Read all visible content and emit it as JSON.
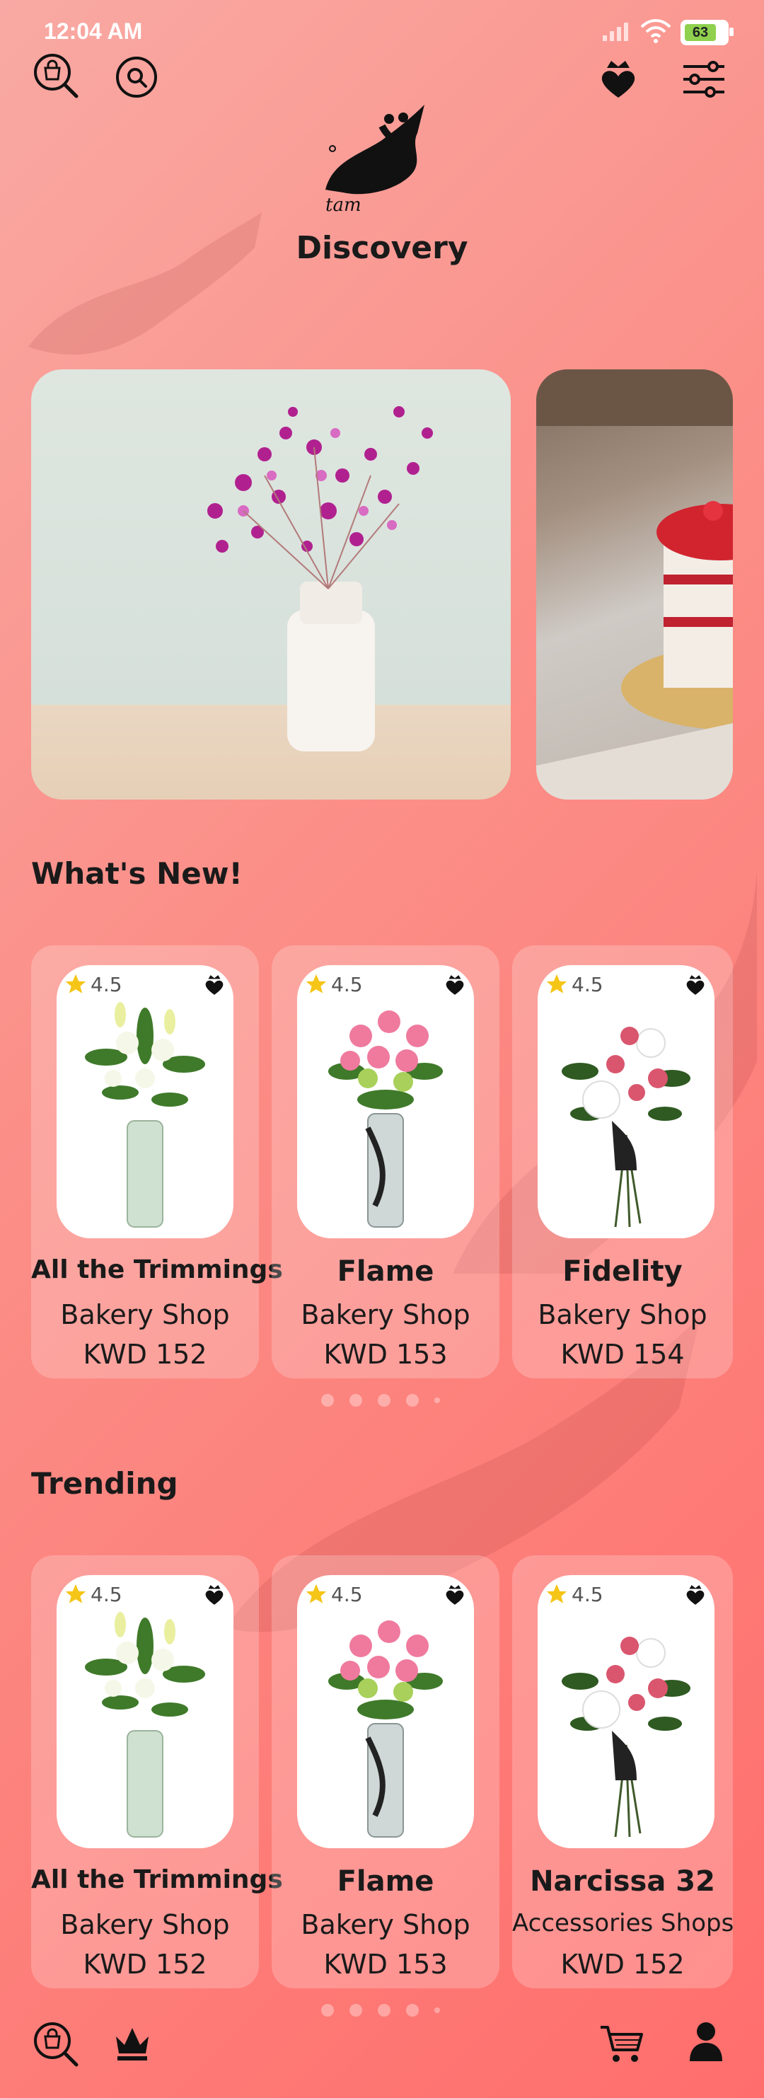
{
  "status_bar": {
    "time": "12:04 AM",
    "battery": "63"
  },
  "header": {
    "title": "Discovery",
    "logo_text": "tam",
    "icons": [
      "shop-search-icon",
      "search-icon",
      "crown-heart-icon",
      "filter-icon"
    ]
  },
  "sections": {
    "new_title": "What's New!",
    "trending_title": "Trending"
  },
  "whats_new": [
    {
      "name": "All the Trimmings",
      "shop": "Bakery Shop",
      "price": "KWD  152",
      "rating": "4.5"
    },
    {
      "name": "Flame",
      "shop": "Bakery Shop",
      "price": "KWD  153",
      "rating": "4.5"
    },
    {
      "name": "Fidelity",
      "shop": "Bakery Shop",
      "price": "KWD  154",
      "rating": "4.5"
    }
  ],
  "trending": [
    {
      "name": "All the Trimmings",
      "shop": "Bakery Shop",
      "price": "KWD  152",
      "rating": "4.5"
    },
    {
      "name": "Flame",
      "shop": "Bakery Shop",
      "price": "KWD  153",
      "rating": "4.5"
    },
    {
      "name": "Narcissa 32",
      "shop": "Accessories Shops",
      "price": "KWD  152",
      "rating": "4.5"
    }
  ],
  "bottom_nav": [
    "shop-search-icon",
    "crown-icon",
    "cart-icon",
    "profile-icon"
  ],
  "colors": {
    "accent": "#ff6e6c",
    "star": "#f5c518"
  }
}
